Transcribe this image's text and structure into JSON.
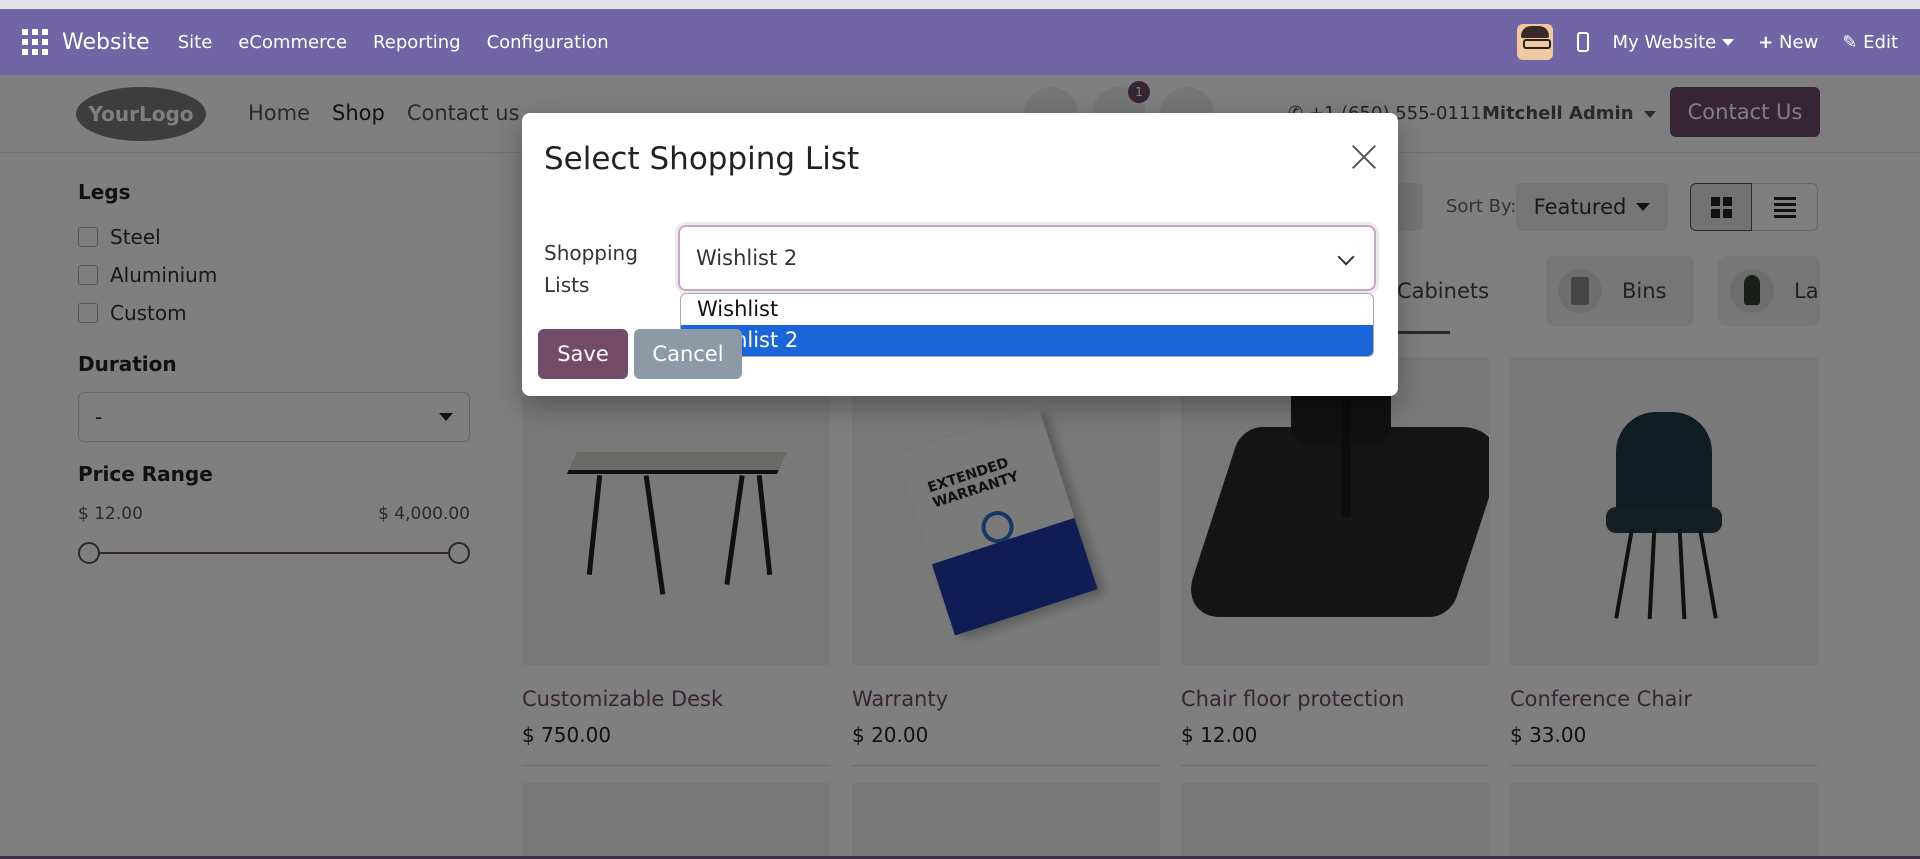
{
  "topbar": {
    "app_name": "Website",
    "menu": [
      "Site",
      "eCommerce",
      "Reporting",
      "Configuration"
    ],
    "website_selector": "My Website",
    "new_label": "New",
    "edit_label": "Edit",
    "bg_color": "#7165a5"
  },
  "header": {
    "logo_text": "YourLogo",
    "nav": [
      "Home",
      "Shop",
      "Contact us"
    ],
    "active_nav": "Shop",
    "wishlist_count": "1",
    "phone": "+1 (650) 555-0111",
    "user": "Mitchell Admin",
    "contact_button": "Contact Us",
    "brand_color": "#714b67"
  },
  "sidebar": {
    "legs_title": "Legs",
    "legs_options": [
      "Steel",
      "Aluminium",
      "Custom"
    ],
    "duration_title": "Duration",
    "duration_value": "-",
    "price_title": "Price Range",
    "price_min": "$ 12.00",
    "price_max": "$ 4,000.00"
  },
  "controls": {
    "sort_label": "Sort By:",
    "sort_value": "Featured"
  },
  "categories": [
    "Cabinets",
    "Bins",
    "La"
  ],
  "products": [
    {
      "name": "Customizable Desk",
      "price": "$ 750.00"
    },
    {
      "name": "Warranty",
      "price": "$ 20.00"
    },
    {
      "name": "Chair floor protection",
      "price": "$ 12.00"
    },
    {
      "name": "Conference Chair",
      "price": "$ 33.00"
    }
  ],
  "warranty_box_text": "EXTENDED WARRANTY",
  "modal": {
    "title": "Select Shopping List",
    "field_label": "Shopping Lists",
    "selected_value": "Wishlist 2",
    "options": [
      "Wishlist",
      "Wishlist 2"
    ],
    "highlighted_option": "Wishlist 2",
    "save_label": "Save",
    "cancel_label": "Cancel",
    "highlight_color": "#1a66d8"
  }
}
